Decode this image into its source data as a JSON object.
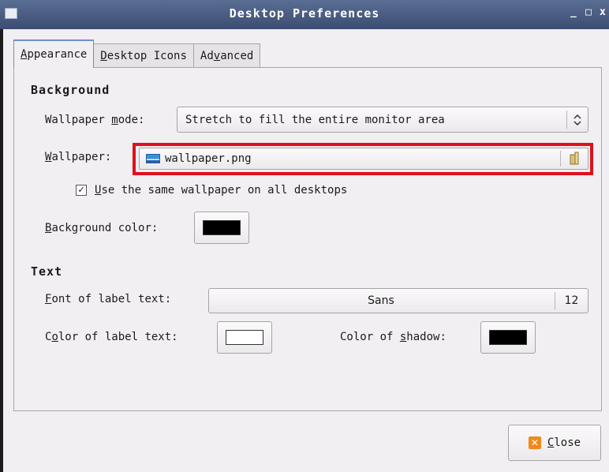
{
  "window": {
    "title": "Desktop Preferences",
    "minimize_glyph": "_",
    "maximize_glyph": "□",
    "close_glyph": "x"
  },
  "tabs": [
    {
      "label": "Appearance",
      "mnemonic": "A",
      "rest": "ppearance",
      "active": true
    },
    {
      "label": "Desktop Icons",
      "mnemonic": "D",
      "rest": "esktop Icons",
      "active": false
    },
    {
      "label": "Advanced",
      "pre": "Ad",
      "mnemonic": "v",
      "rest": "anced",
      "active": false
    }
  ],
  "background": {
    "section_title": "Background",
    "wallpaper_mode": {
      "label_pre": "Wallpaper ",
      "label_mnemonic": "m",
      "label_post": "ode:",
      "value": "Stretch to fill the entire monitor area"
    },
    "wallpaper": {
      "label_mnemonic": "W",
      "label_post": "allpaper:",
      "value": "wallpaper.png"
    },
    "same_wallpaper": {
      "checked": true,
      "check_glyph": "✓",
      "label_mnemonic": "U",
      "label_post": "se the same wallpaper on all desktops"
    },
    "background_color": {
      "label_mnemonic": "B",
      "label_post": "ackground color:",
      "value": "#000000"
    }
  },
  "text": {
    "section_title": "Text",
    "font": {
      "label_mnemonic": "F",
      "label_post": "ont of label text:",
      "family": "Sans",
      "size": "12"
    },
    "label_color": {
      "label_pre": "C",
      "label_mnemonic": "o",
      "label_post": "lor of label text:",
      "value": "#ffffff"
    },
    "shadow_color": {
      "label_pre": "Color of ",
      "label_mnemonic": "s",
      "label_post": "hadow:",
      "value": "#000000"
    }
  },
  "footer": {
    "close_mnemonic": "C",
    "close_rest": "lose",
    "close_icon_glyph": "✕"
  },
  "colors": {
    "highlight_border": "#e0101b",
    "titlebar": "#4a5c82",
    "active_tab_accent": "#6e8ed5"
  }
}
